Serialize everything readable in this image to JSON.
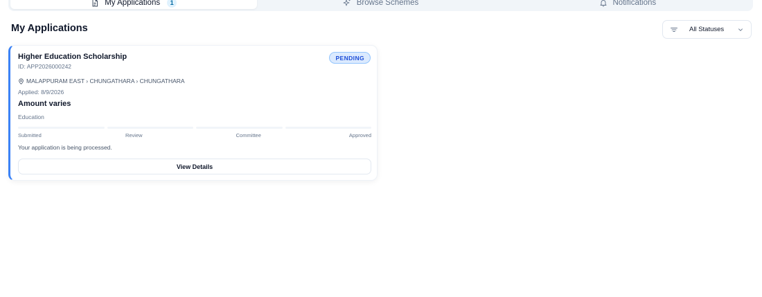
{
  "tabs": [
    {
      "label": "My Applications",
      "count": "1",
      "icon": "document-icon",
      "active": true
    },
    {
      "label": "Browse Schemes",
      "icon": "sparkles-icon",
      "active": false
    },
    {
      "label": "Notifications",
      "icon": "bell-icon",
      "active": false
    }
  ],
  "header": {
    "title": "My Applications",
    "status_filter": {
      "selected": "All Statuses",
      "icon": "filter-icon"
    }
  },
  "applications": [
    {
      "title": "Higher Education Scholarship",
      "id": "ID: APP2026000242",
      "status": "PENDING",
      "location": "MALAPPURAM EAST › CHUNGATHARA › CHUNGATHARA",
      "applied": "Applied: 8/9/2026",
      "amount": "Amount varies",
      "category": "Education",
      "steps": [
        "Submitted",
        "Review",
        "Committee",
        "Approved"
      ],
      "message": "Your application is being processed.",
      "action_label": "View Details"
    }
  ],
  "colors": {
    "accent": "#3b82f6",
    "badge_bg": "#dbeafe",
    "badge_text": "#1d4ed8",
    "tabbar_bg": "#f1f5f9"
  }
}
